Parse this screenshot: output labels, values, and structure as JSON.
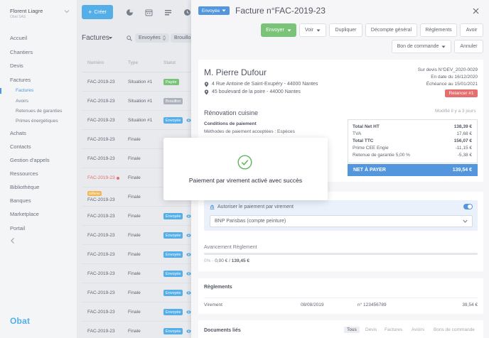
{
  "user": {
    "name": "Florent Liagre",
    "company": "Obat SAS"
  },
  "sidebar": {
    "items": [
      {
        "label": "Accueil"
      },
      {
        "label": "Chantiers"
      },
      {
        "label": "Devis"
      },
      {
        "label": "Factures"
      },
      {
        "label": "Achats"
      },
      {
        "label": "Contacts"
      },
      {
        "label": "Gestion d'appels"
      },
      {
        "label": "Ressources"
      },
      {
        "label": "Bibliothèque"
      },
      {
        "label": "Banques"
      },
      {
        "label": "Marketplace"
      },
      {
        "label": "Portail"
      }
    ],
    "subitems": [
      {
        "label": "Factures"
      },
      {
        "label": "Avoirs"
      },
      {
        "label": "Retenues de garanties"
      },
      {
        "label": "Primes énergétiques"
      }
    ],
    "logo": "Obat"
  },
  "toolbar": {
    "create_label": "Créer"
  },
  "list": {
    "title": "Factures",
    "filters": [
      {
        "label": "Envoyées"
      },
      {
        "label": "Brouillo"
      }
    ],
    "columns": {
      "number": "Numéro",
      "type": "Type",
      "status": "Statut"
    },
    "rows": [
      {
        "number": "FAC-2019-23",
        "type": "Situation #1",
        "status": "Payée",
        "status_color": "#5cb85c"
      },
      {
        "number": "FAC-2019-23",
        "type": "Situation #1",
        "status": "Brouillon",
        "status_color": "#9aa1ad"
      },
      {
        "number": "FAC-2019-23",
        "type": "Situation #1",
        "status": "Envoyée",
        "status_color": "#2f9de3"
      },
      {
        "number": "FAC-2019-23",
        "type": "Finale",
        "status": "",
        "status_color": ""
      },
      {
        "number": "FAC-2019-23",
        "type": "Finale",
        "status": "",
        "status_color": ""
      },
      {
        "number": "FAC-2019-23",
        "type": "Finale",
        "status": "",
        "status_color": "",
        "overdue": true
      },
      {
        "number": "FAC-2019-23",
        "type": "Finale",
        "status": "",
        "status_color": "",
        "tag": "Différée"
      },
      {
        "number": "FAC-2019-23",
        "type": "Finale",
        "status": "Envoyée",
        "status_color": "#2f9de3"
      },
      {
        "number": "FAC-2019-23",
        "type": "Finale",
        "status": "Envoyée",
        "status_color": "#2f9de3"
      },
      {
        "number": "FAC-2019-23",
        "type": "Finale",
        "status": "Envoyée",
        "status_color": "#2f9de3"
      },
      {
        "number": "FAC-2019-23",
        "type": "Finale",
        "status": "Envoyée",
        "status_color": "#2f9de3"
      },
      {
        "number": "FAC-2019-23",
        "type": "Finale",
        "status": "Envoyée",
        "status_color": "#2f9de3"
      },
      {
        "number": "FAC-2019-23",
        "type": "Finale",
        "status": "Envoyée",
        "status_color": "#2f9de3"
      },
      {
        "number": "FAC-2019-23",
        "type": "Finale",
        "status": "Envoyée",
        "status_color": "#2f9de3"
      }
    ]
  },
  "invoice": {
    "status": "Envoyée",
    "title": "Facture n°FAC-2019-23",
    "actions": {
      "send": "Envoyer",
      "view": "Voir",
      "duplicate": "Dupliquer",
      "general": "Décompte général",
      "payments": "Règlements",
      "credit": "Avoir",
      "order": "Bon de commande",
      "cancel": "Annuler"
    },
    "client": {
      "name": "M. Pierre Dufour",
      "address1": "4 Rue Antoine de Saint-Exupéry - 44000 Nantes",
      "address2": "45 boulevard de la poire - 44000 Nantes"
    },
    "meta": {
      "quote": "Sur devis N°DEV_2020-0029",
      "date": "En date du 16/12/2020",
      "due": "Échéance au 15/01/2021",
      "remind": "Relancer #1"
    },
    "project": "Rénovation cuisine",
    "modified": "Modifié il y a 3 jours",
    "conditions_title": "Conditions de paiement",
    "conditions_text": "Méthodes de paiement acceptées : Espèces",
    "totals": [
      {
        "label": "Total Net HT",
        "value": "138,39 €",
        "bold": true
      },
      {
        "label": "TVA",
        "value": "17,68 €",
        "bold": false
      },
      {
        "label": "Total TTC",
        "value": "156,07 €",
        "bold": true
      },
      {
        "label": "Prime CEE Engie",
        "value": "-11,15 €",
        "bold": false
      },
      {
        "label": "Retenue de garantie 5,00 %",
        "value": "-5,38 €",
        "bold": false
      }
    ],
    "net_label": "NET À PAYER",
    "net_value": "139,54 €",
    "transfer_label": "Autoriser le paiement par virement",
    "transfer_enabled": true,
    "bank_account": "BNP Parisbas (compte peinture)",
    "progress_title": "Avancement Règlement",
    "progress_percent": "0%",
    "progress_paid": "0,00 €",
    "progress_total": "139,45 €",
    "progress_fraction": 0,
    "payments_title": "Règlements",
    "payment": {
      "method": "Virement",
      "date": "08/08/2019",
      "ref": "n° 123456789",
      "amount": "39,54 €"
    },
    "docs_title": "Documents liés",
    "doc_tabs": [
      {
        "label": "Tous"
      },
      {
        "label": "Devis"
      },
      {
        "label": "Factures"
      },
      {
        "label": "Avoirs"
      },
      {
        "label": "Bons de commande"
      }
    ]
  },
  "modal": {
    "message": "Paiement par virement activé avec succès"
  }
}
